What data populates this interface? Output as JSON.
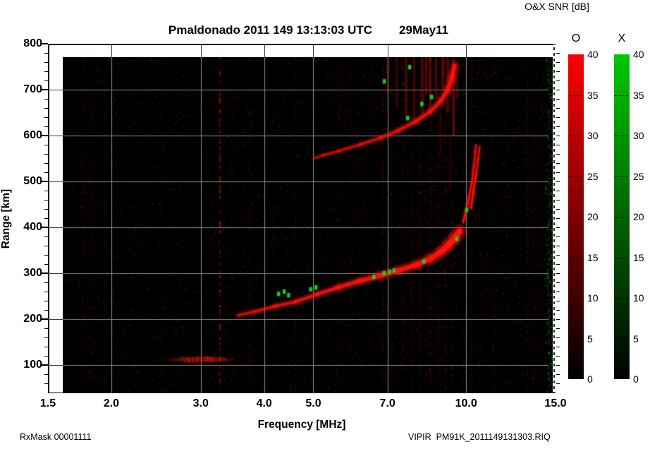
{
  "header": {
    "title": "Pmaldonado 2011 149 13:13:03 UTC",
    "date": "29May11",
    "colorbar_title": "O&X SNR [dB]"
  },
  "footer": {
    "left": "RxMask 00001111",
    "right": "VIPIR  PM91K_2011149131303.RIQ"
  },
  "chart_data": {
    "type": "heatmap",
    "subtype": "ionogram",
    "title": "Pmaldonado 2011 149 13:13:03 UTC  29May11",
    "xlabel": "Frequency [MHz]",
    "ylabel": "Range [km]",
    "x_scale": "log",
    "xlim": [
      1.5,
      15.0
    ],
    "ylim": [
      40,
      800
    ],
    "grid": true,
    "x_ticks": [
      {
        "v": 1.5,
        "label": "1.5"
      },
      {
        "v": 2.0,
        "label": "2.0"
      },
      {
        "v": 3.0,
        "label": "3.0"
      },
      {
        "v": 4.0,
        "label": "4.0"
      },
      {
        "v": 5.0,
        "label": "5.0"
      },
      {
        "v": 7.0,
        "label": "7.0"
      },
      {
        "v": 10.0,
        "label": "10.0"
      },
      {
        "v": 15.0,
        "label": "15.0"
      }
    ],
    "x_gridlines": [
      2,
      3,
      4,
      5,
      7,
      10
    ],
    "y_ticks": [
      {
        "v": 100,
        "label": "100"
      },
      {
        "v": 200,
        "label": "200"
      },
      {
        "v": 300,
        "label": "300"
      },
      {
        "v": 400,
        "label": "400"
      },
      {
        "v": 500,
        "label": "500"
      },
      {
        "v": 600,
        "label": "600"
      },
      {
        "v": 700,
        "label": "700"
      },
      {
        "v": 800,
        "label": "800"
      }
    ],
    "y_minor_step_km": 20,
    "background_color": "#000000",
    "grid_color": "#8c8c8c",
    "colorbars": {
      "unit": "dB",
      "min": 0,
      "max": 40,
      "tick_step": 5,
      "tick_labels": [
        "40",
        "35",
        "30",
        "25",
        "20",
        "15",
        "10",
        "5",
        "0"
      ],
      "bars": [
        {
          "name": "O",
          "top_color": "#fa0000"
        },
        {
          "name": "X",
          "top_color": "#00c800"
        }
      ]
    },
    "traces": {
      "f_layer_first_hop_points_MHz_km": [
        [
          3.55,
          208
        ],
        [
          3.82,
          216
        ],
        [
          4.2,
          228
        ],
        [
          4.62,
          238
        ],
        [
          5.09,
          254
        ],
        [
          5.6,
          269
        ],
        [
          6.17,
          283
        ],
        [
          6.79,
          295
        ],
        [
          7.35,
          306
        ],
        [
          7.96,
          318
        ],
        [
          8.49,
          331
        ],
        [
          8.91,
          346
        ],
        [
          9.2,
          360
        ],
        [
          9.5,
          377
        ],
        [
          9.71,
          392
        ]
      ],
      "critical_cusp_arcs_MHz_km": [
        [
          [
            9.87,
            411
          ],
          [
            10.0,
            437
          ],
          [
            10.13,
            465
          ],
          [
            10.26,
            498
          ],
          [
            10.36,
            534
          ],
          [
            10.42,
            565
          ],
          [
            10.46,
            580
          ]
        ],
        [
          [
            10.23,
            442
          ],
          [
            10.33,
            477
          ],
          [
            10.46,
            514
          ],
          [
            10.56,
            549
          ],
          [
            10.63,
            575
          ]
        ]
      ],
      "second_hop_points_MHz_km": [
        [
          5.01,
          550
        ],
        [
          5.22,
          557
        ],
        [
          5.61,
          566
        ],
        [
          6.17,
          580
        ],
        [
          6.79,
          595
        ],
        [
          7.35,
          611
        ],
        [
          7.96,
          631
        ],
        [
          8.49,
          652
        ],
        [
          8.91,
          675
        ],
        [
          9.2,
          700
        ],
        [
          9.38,
          726
        ],
        [
          9.48,
          752
        ]
      ],
      "e_layer": {
        "f_start": 2.55,
        "f_end": 3.5,
        "range_km": 112,
        "alpha": 0.5
      },
      "x_mode_green_echoes_MHz_km": [
        [
          4.27,
          255
        ],
        [
          4.38,
          260
        ],
        [
          4.47,
          252
        ],
        [
          4.94,
          265
        ],
        [
          5.06,
          269
        ],
        [
          6.58,
          292
        ],
        [
          6.89,
          300
        ],
        [
          7.06,
          303
        ],
        [
          7.21,
          306
        ],
        [
          8.26,
          326
        ],
        [
          9.59,
          375
        ],
        [
          10.03,
          438
        ],
        [
          7.67,
          638
        ],
        [
          8.18,
          669
        ],
        [
          8.55,
          684
        ],
        [
          6.9,
          718
        ],
        [
          7.74,
          749
        ]
      ],
      "spread_streaks_MHz_km1_km2_alpha": [
        [
          7.0,
          690,
          770,
          0.22
        ],
        [
          7.3,
          660,
          772,
          0.18
        ],
        [
          7.62,
          640,
          775,
          0.28
        ],
        [
          7.9,
          620,
          775,
          0.22
        ],
        [
          8.2,
          640,
          770,
          0.3
        ],
        [
          8.35,
          690,
          775,
          0.28
        ],
        [
          8.5,
          660,
          775,
          0.33
        ],
        [
          8.72,
          680,
          770,
          0.28
        ],
        [
          9.0,
          700,
          775,
          0.33
        ],
        [
          9.2,
          650,
          770,
          0.28
        ],
        [
          9.45,
          600,
          770,
          0.33
        ],
        [
          9.6,
          680,
          760,
          0.22
        ],
        [
          8.9,
          560,
          660,
          0.12
        ],
        [
          9.3,
          480,
          600,
          0.1
        ]
      ],
      "rfi_bands_MHz_intensity": [
        [
          1.76,
          0.1
        ],
        [
          1.82,
          0.08
        ],
        [
          2.1,
          0.06
        ],
        [
          2.52,
          0.1
        ],
        [
          3.27,
          0.5
        ],
        [
          3.45,
          0.08
        ],
        [
          3.75,
          0.13
        ],
        [
          4.18,
          0.08
        ],
        [
          4.6,
          0.1
        ],
        [
          5.0,
          0.08
        ],
        [
          5.35,
          0.07
        ],
        [
          5.6,
          0.08
        ],
        [
          5.95,
          0.1
        ],
        [
          6.3,
          0.08
        ],
        [
          6.85,
          0.16
        ],
        [
          7.1,
          0.13
        ],
        [
          7.5,
          0.16
        ],
        [
          7.8,
          0.13
        ],
        [
          8.1,
          0.16
        ],
        [
          8.5,
          0.2
        ],
        [
          8.8,
          0.16
        ],
        [
          9.1,
          0.2
        ],
        [
          9.4,
          0.16
        ],
        [
          9.9,
          0.12
        ],
        [
          10.6,
          0.07
        ],
        [
          11.3,
          0.1
        ],
        [
          12.0,
          0.08
        ],
        [
          13.2,
          0.15
        ],
        [
          13.6,
          0.12
        ],
        [
          14.1,
          0.1
        ]
      ],
      "green_rfi_bands_MHz_intensity": [
        [
          14.55,
          0.2
        ],
        [
          14.75,
          0.18
        ]
      ]
    }
  }
}
